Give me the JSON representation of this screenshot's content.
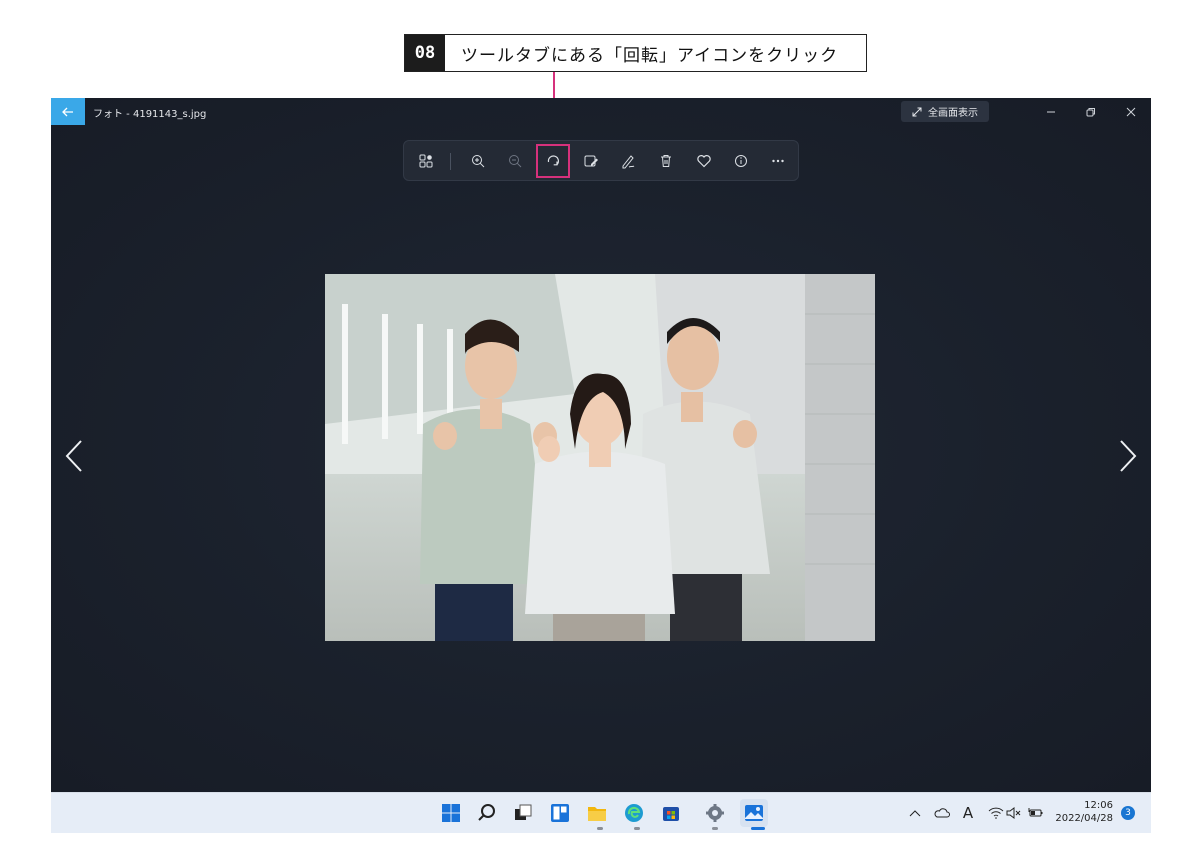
{
  "annotation": {
    "step_number": "08",
    "instruction": "ツールタブにある「回転」アイコンをクリック",
    "highlight_color": "#d6317c"
  },
  "window": {
    "title": "フォト - 4191143_s.jpg",
    "fullscreen_label": "全画面表示",
    "accent_color": "#3aa8e8",
    "icons": [
      "back-arrow-icon",
      "expand-icon",
      "minimize-icon",
      "restore-icon",
      "close-icon"
    ]
  },
  "toolbar": {
    "items": [
      "gallery-icon",
      "zoom-in-icon",
      "zoom-out-icon",
      "rotate-icon",
      "edit-image-icon",
      "draw-icon",
      "delete-icon",
      "favorite-icon",
      "info-icon",
      "more-icon"
    ]
  },
  "viewer": {
    "image_subject": "photo of three workers in light grey work jackets",
    "icons": [
      "chevron-left-icon",
      "chevron-right-icon"
    ]
  },
  "taskbar": {
    "apps": [
      "windows-start-icon",
      "search-icon",
      "task-view-icon",
      "widgets-icon",
      "file-explorer-icon",
      "edge-icon",
      "store-icon",
      "settings-icon",
      "photos-icon"
    ],
    "tray": [
      "chevron-up-icon",
      "onedrive-icon",
      "ime-icon",
      "wifi-icon",
      "volume-muted-icon",
      "battery-icon"
    ],
    "ime_label": "A",
    "time": "12:06",
    "date": "2022/04/28",
    "notification_count": "3"
  }
}
